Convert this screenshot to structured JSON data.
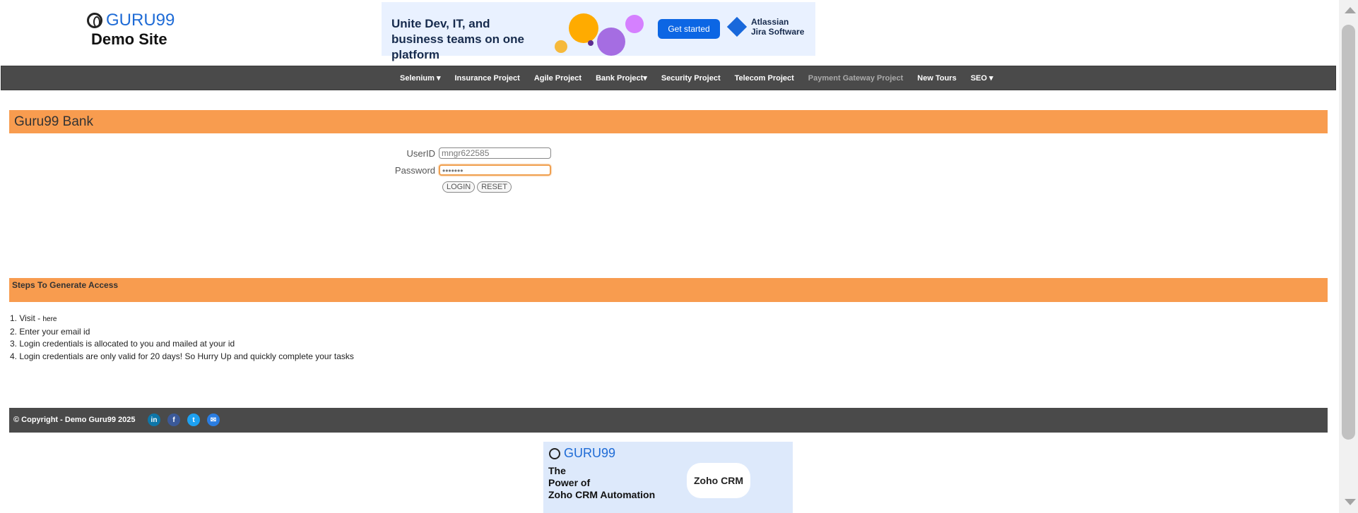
{
  "header": {
    "brand": "GURU99",
    "subtitle": "Demo Site"
  },
  "top_ad": {
    "headline": "Unite Dev, IT, and business teams on one platform",
    "cta": "Get started",
    "product_line1": "Atlassian",
    "product_line2": "Jira Software",
    "icon": "jira-diamond-icon"
  },
  "nav": {
    "items": [
      {
        "label": "Selenium ▾"
      },
      {
        "label": "Insurance Project"
      },
      {
        "label": "Agile Project"
      },
      {
        "label": "Bank Project▾"
      },
      {
        "label": "Security Project"
      },
      {
        "label": "Telecom Project"
      },
      {
        "label": "Payment Gateway Project"
      },
      {
        "label": "New Tours"
      },
      {
        "label": "SEO ▾"
      }
    ]
  },
  "bank_title": "Guru99 Bank",
  "login": {
    "userid_label": "UserID",
    "userid_value": "mngr622585",
    "password_label": "Password",
    "password_value": "•••••••",
    "login_button": "LOGIN",
    "reset_button": "RESET"
  },
  "steps": {
    "title": "Steps To Generate Access",
    "step1_prefix": "1. Visit - ",
    "step1_link": "here",
    "step2": "2. Enter your email id",
    "step3": "3. Login credentials is allocated to you and mailed at your id",
    "step4": "4. Login credentials are only valid for 20 days! So Hurry Up and quickly complete your tasks"
  },
  "footer": {
    "copyright": "© Copyright - Demo Guru99 2025",
    "social": [
      {
        "icon": "linkedin-icon",
        "glyph": "in",
        "color": "#0e76a8"
      },
      {
        "icon": "facebook-icon",
        "glyph": "f",
        "color": "#3b5998"
      },
      {
        "icon": "twitter-icon",
        "glyph": "t",
        "color": "#1da1f2"
      },
      {
        "icon": "email-icon",
        "glyph": "✉",
        "color": "#2a7de1"
      }
    ]
  },
  "bottom_ad": {
    "brand": "GURU99",
    "line1": "The",
    "line2": "Power of",
    "line3": "Zoho CRM Automation",
    "product": "Zoho CRM"
  }
}
